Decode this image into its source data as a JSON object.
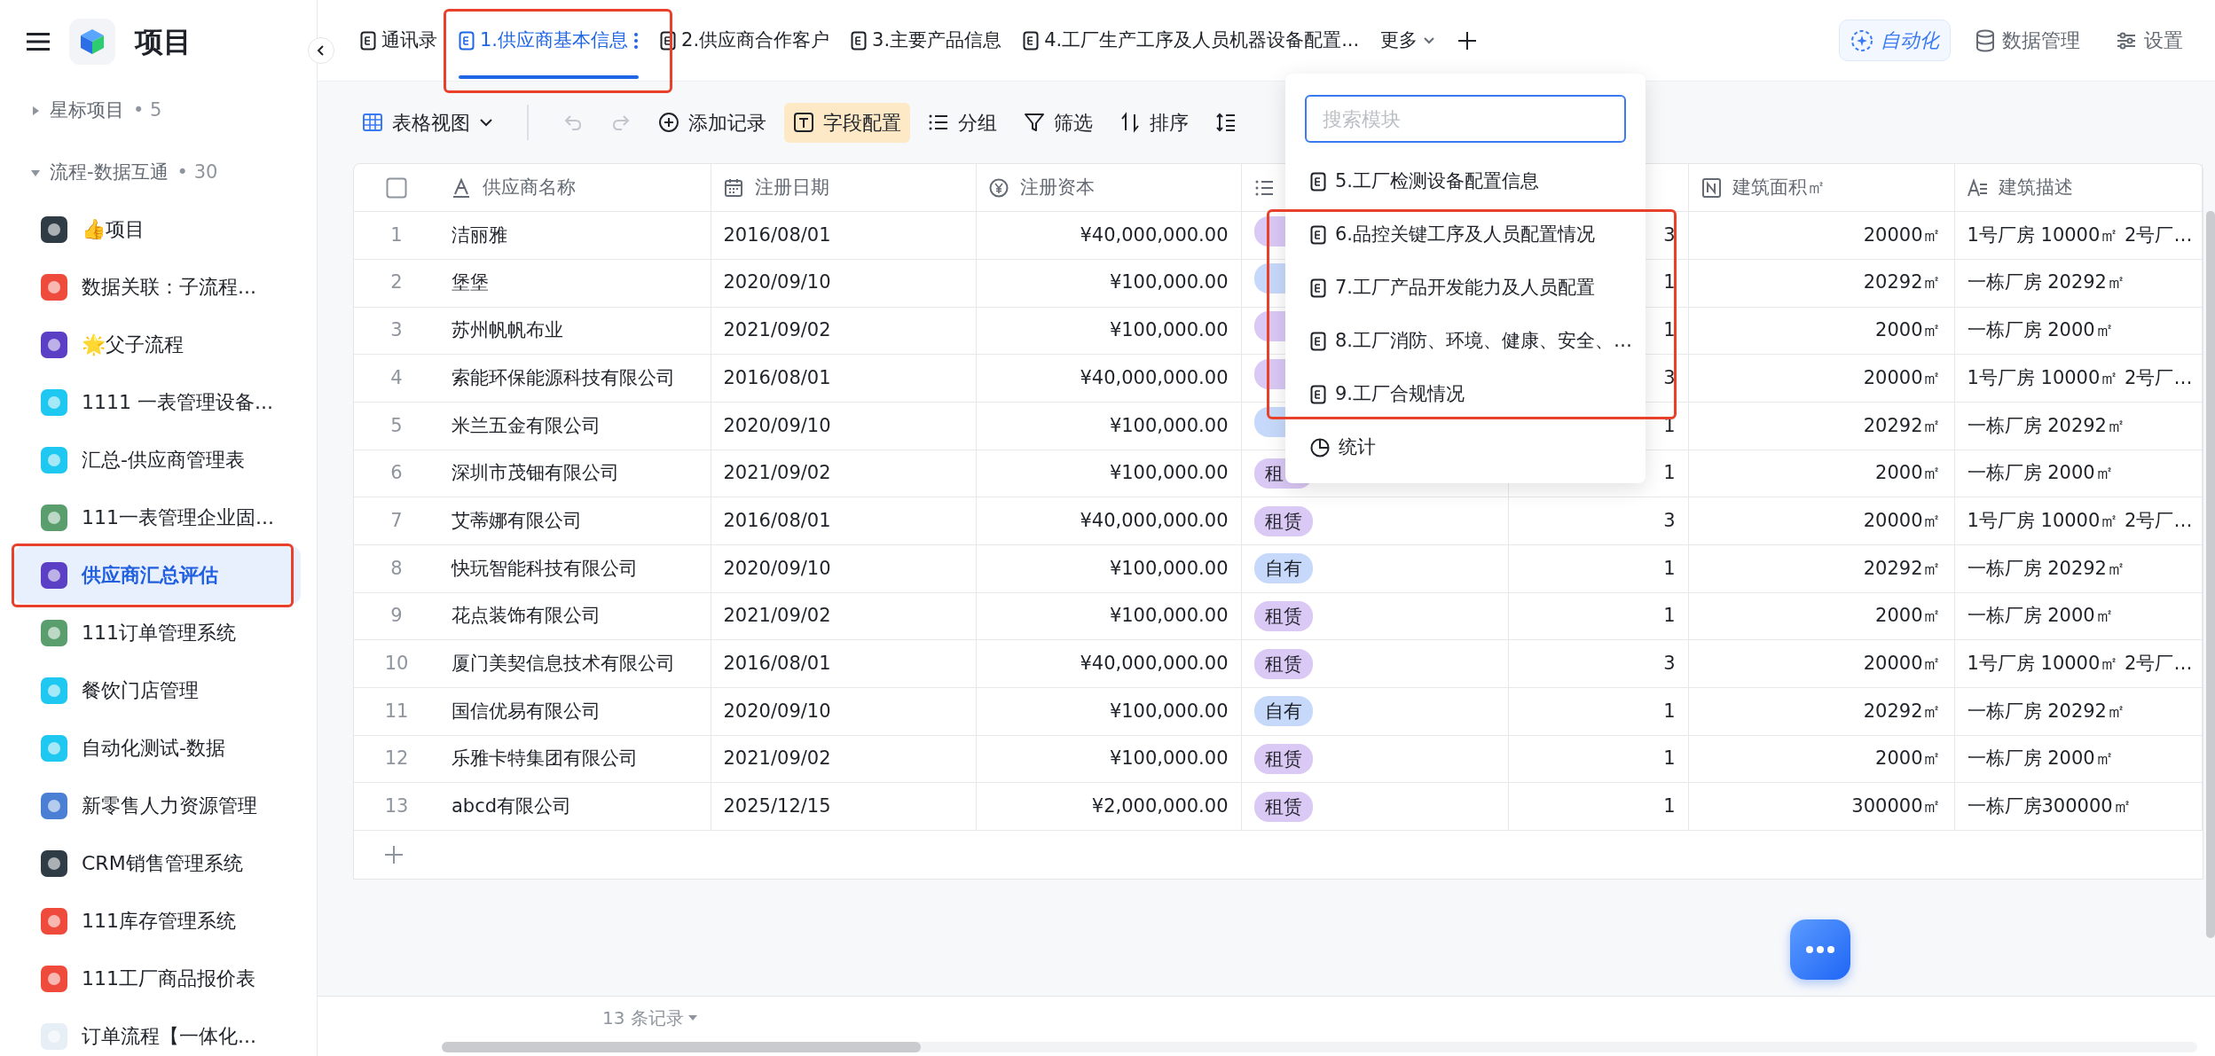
{
  "sidebar": {
    "title": "项目",
    "groups": [
      {
        "label": "星标项目",
        "count": "• 5",
        "expanded": false
      },
      {
        "label": "流程-数据互通",
        "count": "• 30",
        "expanded": true,
        "items": [
          {
            "label": "👍项目",
            "color": "#2f3b45",
            "selected": false
          },
          {
            "label": "数据关联：子流程...",
            "color": "#ef4b3c",
            "selected": false
          },
          {
            "label": "🌟父子流程",
            "color": "#5b3fc4",
            "selected": false
          },
          {
            "label": "1111 一表管理设备...",
            "color": "#1ec8f0",
            "selected": false
          },
          {
            "label": "汇总-供应商管理表",
            "color": "#1ec8f0",
            "selected": false
          },
          {
            "label": "111一表管理企业固...",
            "color": "#5a9e6e",
            "selected": false
          },
          {
            "label": "供应商汇总评估",
            "color": "#5b3fc4",
            "selected": true
          },
          {
            "label": "111订单管理系统",
            "color": "#5a9e6e",
            "selected": false
          },
          {
            "label": "餐饮门店管理",
            "color": "#1ec8f0",
            "selected": false
          },
          {
            "label": "自动化测试-数据",
            "color": "#1ec8f0",
            "selected": false
          },
          {
            "label": "新零售人力资源管理",
            "color": "#4a7fd4",
            "selected": false
          },
          {
            "label": "CRM销售管理系统",
            "color": "#2f3b45",
            "selected": false
          },
          {
            "label": "111库存管理系统",
            "color": "#ef4b3c",
            "selected": false
          },
          {
            "label": "111工厂商品报价表",
            "color": "#ef4b3c",
            "selected": false
          },
          {
            "label": "订单流程【一体化...",
            "color": "#e6eef6",
            "selected": false
          }
        ]
      }
    ]
  },
  "tabs": [
    {
      "label": "通讯录",
      "selected": false
    },
    {
      "label": "1.供应商基本信息",
      "selected": true
    },
    {
      "label": "2.供应商合作客户",
      "selected": false
    },
    {
      "label": "3.主要产品信息",
      "selected": false
    },
    {
      "label": "4.工厂生产工序及人员机器设备配置...",
      "selected": false
    }
  ],
  "more_label": "更多",
  "top_actions": [
    {
      "kind": "automation",
      "label": "自动化"
    },
    {
      "kind": "data",
      "label": "数据管理"
    },
    {
      "kind": "settings",
      "label": "设置"
    }
  ],
  "toolbar": [
    {
      "kind": "view",
      "label": "表格视图",
      "disabled": false,
      "active": false
    },
    {
      "kind": "undo",
      "disabled": true,
      "active": false
    },
    {
      "kind": "redo",
      "disabled": true,
      "active": false
    },
    {
      "kind": "add",
      "label": "添加记录",
      "disabled": false,
      "active": false
    },
    {
      "kind": "fields",
      "label": "字段配置",
      "disabled": false,
      "active": true
    },
    {
      "kind": "group",
      "label": "分组",
      "disabled": false,
      "active": false
    },
    {
      "kind": "filter",
      "label": "筛选",
      "disabled": false,
      "active": false
    },
    {
      "kind": "sort",
      "label": "排序",
      "disabled": false,
      "active": false
    },
    {
      "kind": "rowheight",
      "disabled": false,
      "active": false
    }
  ],
  "table": {
    "select_all": {
      "checked": false
    },
    "columns": [
      {
        "kind": "text",
        "label": "供应商名称"
      },
      {
        "kind": "date",
        "label": "注册日期"
      },
      {
        "kind": "money",
        "label": "注册资本"
      },
      {
        "kind": "option"
      },
      {
        "kind": "none"
      },
      {
        "kind": "number",
        "label": "建筑面积㎡"
      },
      {
        "kind": "longtext",
        "label": "建筑描述"
      }
    ],
    "rows": [
      {
        "index": "1",
        "name": "洁丽雅",
        "date": "2016/08/01",
        "capital": "¥40,000,000.00",
        "tenure": {
          "kind": "lease"
        },
        "count": "3",
        "area": "20000㎡",
        "description": "1号厂房 10000㎡  2号厂…"
      },
      {
        "index": "2",
        "name": "堡堡",
        "date": "2020/09/10",
        "capital": "¥100,000.00",
        "tenure": {
          "kind": "own"
        },
        "count": "1",
        "area": "20292㎡",
        "description": "一栋厂房 20292㎡"
      },
      {
        "index": "3",
        "name": "苏州帆帆布业",
        "date": "2021/09/02",
        "capital": "¥100,000.00",
        "tenure": {
          "kind": "lease"
        },
        "count": "1",
        "area": "2000㎡",
        "description": "一栋厂房 2000㎡"
      },
      {
        "index": "4",
        "name": "索能环保能源科技有限公司",
        "date": "2016/08/01",
        "capital": "¥40,000,000.00",
        "tenure": {
          "kind": "lease"
        },
        "count": "3",
        "area": "20000㎡",
        "description": "1号厂房 10000㎡  2号厂…"
      },
      {
        "index": "5",
        "name": "米兰五金有限公司",
        "date": "2020/09/10",
        "capital": "¥100,000.00",
        "tenure": {
          "kind": "own"
        },
        "count": "1",
        "area": "20292㎡",
        "description": "一栋厂房 20292㎡"
      },
      {
        "index": "6",
        "name": "深圳市茂钿有限公司",
        "date": "2021/09/02",
        "capital": "¥100,000.00",
        "tenure": {
          "kind": "lease",
          "label": "租"
        },
        "count": "1",
        "area": "2000㎡",
        "description": "一栋厂房 2000㎡"
      },
      {
        "index": "7",
        "name": "艾蒂娜有限公司",
        "date": "2016/08/01",
        "capital": "¥40,000,000.00",
        "tenure": {
          "kind": "lease",
          "label": "租赁"
        },
        "count": "3",
        "area": "20000㎡",
        "description": "1号厂房 10000㎡  2号厂…"
      },
      {
        "index": "8",
        "name": "快玩智能科技有限公司",
        "date": "2020/09/10",
        "capital": "¥100,000.00",
        "tenure": {
          "kind": "own",
          "label": "自有"
        },
        "count": "1",
        "area": "20292㎡",
        "description": "一栋厂房 20292㎡"
      },
      {
        "index": "9",
        "name": "花点装饰有限公司",
        "date": "2021/09/02",
        "capital": "¥100,000.00",
        "tenure": {
          "kind": "lease",
          "label": "租赁"
        },
        "count": "1",
        "area": "2000㎡",
        "description": "一栋厂房 2000㎡"
      },
      {
        "index": "10",
        "name": "厦门美契信息技术有限公司",
        "date": "2016/08/01",
        "capital": "¥40,000,000.00",
        "tenure": {
          "kind": "lease",
          "label": "租赁"
        },
        "count": "3",
        "area": "20000㎡",
        "description": "1号厂房 10000㎡  2号厂…"
      },
      {
        "index": "11",
        "name": "国信优易有限公司",
        "date": "2020/09/10",
        "capital": "¥100,000.00",
        "tenure": {
          "kind": "own",
          "label": "自有"
        },
        "count": "1",
        "area": "20292㎡",
        "description": "一栋厂房 20292㎡"
      },
      {
        "index": "12",
        "name": "乐雅卡特集团有限公司",
        "date": "2021/09/02",
        "capital": "¥100,000.00",
        "tenure": {
          "kind": "lease",
          "label": "租赁"
        },
        "count": "1",
        "area": "2000㎡",
        "description": "一栋厂房 2000㎡"
      },
      {
        "index": "13",
        "name": "abcd有限公司",
        "date": "2025/12/15",
        "capital": "¥2,000,000.00",
        "tenure": {
          "kind": "lease",
          "label": "租赁"
        },
        "count": "1",
        "area": "300000㎡",
        "description": "一栋厂房300000㎡"
      }
    ]
  },
  "footer": {
    "record_count": "13 条记录"
  },
  "module_menu": {
    "search": {
      "placeholder": "搜索模块"
    },
    "items": [
      {
        "kind": "sheet",
        "label": "5.工厂检测设备配置信息"
      },
      {
        "kind": "sheet",
        "label": "6.品控关键工序及人员配置情况"
      },
      {
        "kind": "sheet",
        "label": "7.工厂产品开发能力及人员配置"
      },
      {
        "kind": "sheet",
        "label": "8.工厂消防、环境、健康、安全、…"
      },
      {
        "kind": "sheet",
        "label": "9.工厂合规情况"
      },
      {
        "kind": "dashboard",
        "label": "统计"
      }
    ]
  }
}
